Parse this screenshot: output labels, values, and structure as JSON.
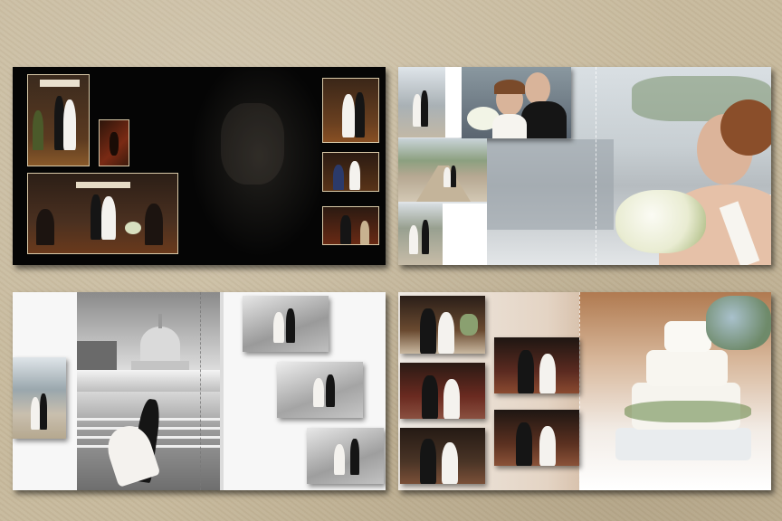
{
  "album": {
    "spreads": [
      {
        "id": "spread-1",
        "style": "black background, ceremony photos"
      },
      {
        "id": "spread-2",
        "style": "portraits on rooftop"
      },
      {
        "id": "spread-3",
        "style": "black and white capitol dome"
      },
      {
        "id": "spread-4",
        "style": "reception and cake"
      }
    ]
  },
  "colors": {
    "backdrop": "#c7b99c",
    "spread_dark": "#050505",
    "spread_light": "#f7f7f7",
    "photo_frame": "#d9c9a8"
  }
}
